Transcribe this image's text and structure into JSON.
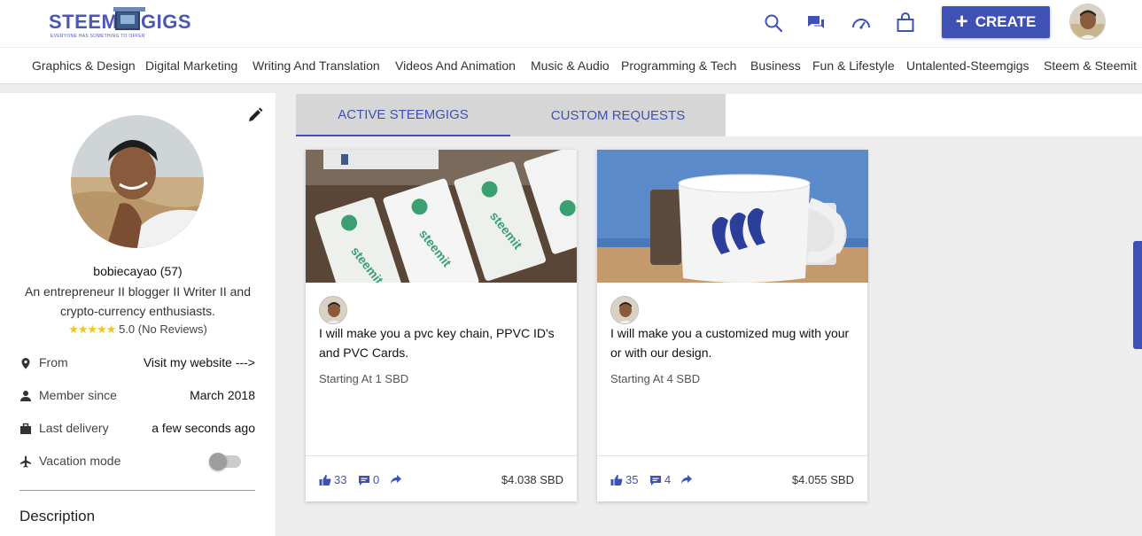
{
  "header": {
    "logo_text_left": "STEEM",
    "logo_text_right": "GIGS",
    "logo_tagline": "EVERYONE HAS SOMETHING TO OFFER",
    "create_label": "CREATE",
    "icons": [
      "search-icon",
      "chat-icon",
      "dashboard-icon",
      "shopping-bag-icon"
    ],
    "accent_color": "#3f51b5"
  },
  "categories": [
    "Graphics & Design",
    "Digital Marketing",
    "Writing And Translation",
    "Videos And Animation",
    "Music & Audio",
    "Programming & Tech",
    "Business",
    "Fun & Lifestyle",
    "Untalented-Steemgigs",
    "Steem & Steemit"
  ],
  "profile": {
    "username": "bobiecayao (57)",
    "bio": "An entrepreneur II blogger II Writer II and crypto-currency enthusiasts.",
    "stars": "★★★★★",
    "rating_text": "5.0 (No Reviews)",
    "rows": [
      {
        "label": "From",
        "value": "Visit my website --->",
        "icon": "location-pin-icon"
      },
      {
        "label": "Member since",
        "value": "March 2018",
        "icon": "person-icon"
      },
      {
        "label": "Last delivery",
        "value": "a few seconds ago",
        "icon": "briefcase-icon"
      },
      {
        "label": "Vacation mode",
        "value": "",
        "icon": "airplane-icon"
      }
    ],
    "vacation_mode": false,
    "description_title": "Description"
  },
  "tabs": [
    {
      "label": "ACTIVE STEEMGIGS",
      "active": true
    },
    {
      "label": "CUSTOM REQUESTS",
      "active": false
    }
  ],
  "gigs": [
    {
      "title": "I will make you a pvc key chain, PPVC ID's and PVC Cards.",
      "starting": "Starting At 1 SBD",
      "likes": "33",
      "comments": "0",
      "price": "$4.038 SBD"
    },
    {
      "title": "I will make you a customized mug with your or with our design.",
      "starting": "Starting At 4 SBD",
      "likes": "35",
      "comments": "4",
      "price": "$4.055 SBD"
    }
  ]
}
